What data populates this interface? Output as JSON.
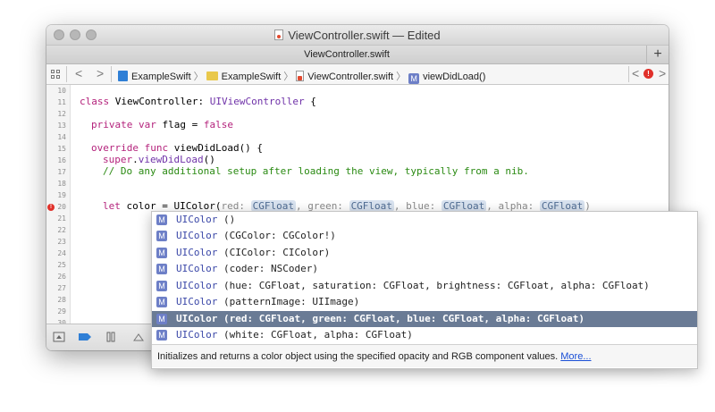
{
  "window": {
    "title": "ViewController.swift — Edited",
    "tab_label": "ViewController.swift",
    "tab_add": "+"
  },
  "jump_bar": {
    "back": "<",
    "forward": ">",
    "crumbs": [
      "ExampleSwift",
      "ExampleSwift",
      "ViewController.swift",
      "viewDidLoad()"
    ],
    "method_badge": "M",
    "error_count": "!",
    "prev_issue": "<",
    "next_issue": ">"
  },
  "editor": {
    "line_numbers": [
      "10",
      "11",
      "12",
      "13",
      "14",
      "15",
      "16",
      "17",
      "18",
      "19",
      "20",
      "21",
      "22",
      "23",
      "24",
      "25",
      "26",
      "27",
      "28",
      "29",
      "30"
    ],
    "lines": {
      "l11": {
        "kw": "class",
        "name": " ViewController: ",
        "type": "UIViewController",
        "rest": " {"
      },
      "l13": {
        "kw": "private var",
        "rest": " flag = ",
        "val": "false"
      },
      "l15": {
        "kw": "override func",
        "rest": " viewDidLoad() {"
      },
      "l16": {
        "kw": "super",
        "rest": ".",
        "fn": "viewDidLoad",
        "tail": "()"
      },
      "l17": {
        "comment": "// Do any additional setup after loading the view, typically from a nib."
      },
      "l20": {
        "kw": "let",
        "prefix": " color = UIColor(",
        "p1": "red:",
        "ph1": "CGFloat",
        "p2": ", green:",
        "ph2": "CGFloat",
        "p3": ", blue:",
        "ph3": "CGFloat",
        "p4": ", alpha:",
        "ph4": "CGFloat",
        "close": ")"
      }
    },
    "error_line": "20"
  },
  "autocomplete": {
    "items": [
      {
        "icon": "M",
        "class_name": "UIColor",
        "signature": " ()"
      },
      {
        "icon": "M",
        "class_name": "UIColor",
        "signature": " (CGColor: CGColor!)"
      },
      {
        "icon": "M",
        "class_name": "UIColor",
        "signature": " (CIColor: CIColor)"
      },
      {
        "icon": "M",
        "class_name": "UIColor",
        "signature": " (coder: NSCoder)"
      },
      {
        "icon": "M",
        "class_name": "UIColor",
        "signature": " (hue: CGFloat, saturation: CGFloat, brightness: CGFloat, alpha: CGFloat)"
      },
      {
        "icon": "M",
        "class_name": "UIColor",
        "signature": " (patternImage: UIImage)"
      },
      {
        "icon": "M",
        "class_name": "UIColor",
        "signature": " (red: CGFloat, green: CGFloat, blue: CGFloat, alpha: CGFloat)"
      },
      {
        "icon": "M",
        "class_name": "UIColor",
        "signature": " (white: CGFloat, alpha: CGFloat)"
      }
    ],
    "selected_index": 6,
    "description": "Initializes and returns a color object using the specified opacity and RGB component values.",
    "more_link": "More..."
  },
  "colors": {
    "keyword": "#b4237c",
    "type": "#6f32a8",
    "comment": "#2a8a12",
    "selection": "#6a7b95",
    "error": "#e0302a",
    "link": "#1a4fd6"
  },
  "icons": [
    "file-icon",
    "grid-icon",
    "project-icon",
    "folder-icon",
    "swift-file-icon",
    "method-icon",
    "error-icon",
    "console-toggle-icon",
    "breakpoint-icon",
    "pause-icon",
    "step-over-icon"
  ]
}
